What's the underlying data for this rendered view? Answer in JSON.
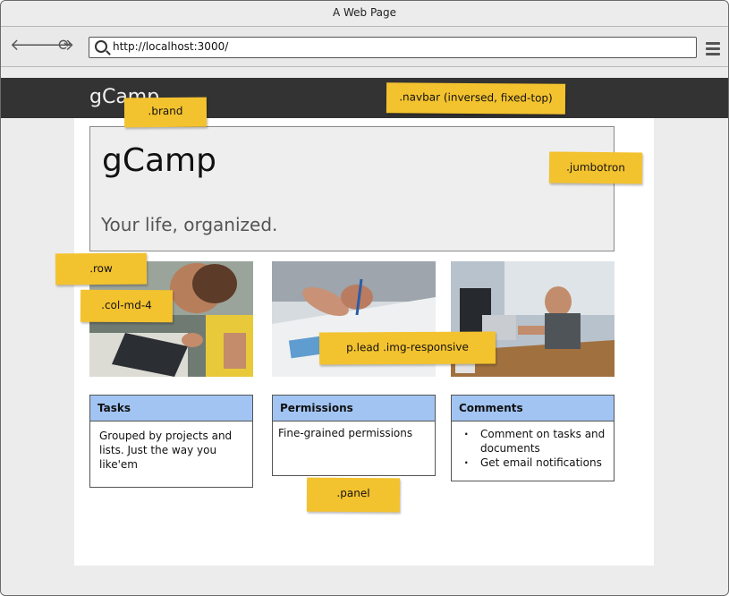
{
  "window": {
    "title": "A Web Page"
  },
  "browser": {
    "url": "http://localhost:3000/"
  },
  "navbar": {
    "brand": "gCamp"
  },
  "jumbotron": {
    "title": "gCamp",
    "lead": "Your life, organized."
  },
  "panels": [
    {
      "heading": "Tasks",
      "body": "Grouped by projects and lists.  Just the way you like'em"
    },
    {
      "heading": "Permissions",
      "body": "Fine-grained permissions"
    },
    {
      "heading": "Comments",
      "items": [
        "Comment on tasks and documents",
        "Get email notifications"
      ]
    }
  ],
  "annotations": {
    "brand": ".brand",
    "navbar": ".navbar (inversed, fixed-top)",
    "jumbotron": ".jumbotron",
    "row": ".row",
    "col": ".col-md-4",
    "img": "p.lead .img-responsive",
    "panel": ".panel"
  },
  "colors": {
    "navbar": "#333333",
    "panel_heading": "#a2c4f2",
    "sticky_note": "#f3c22f",
    "jumbotron": "#eeeeee"
  },
  "icons": [
    "back-arrow-icon",
    "forward-arrow-icon",
    "reload-icon",
    "search-icon",
    "hamburger-menu-icon"
  ]
}
